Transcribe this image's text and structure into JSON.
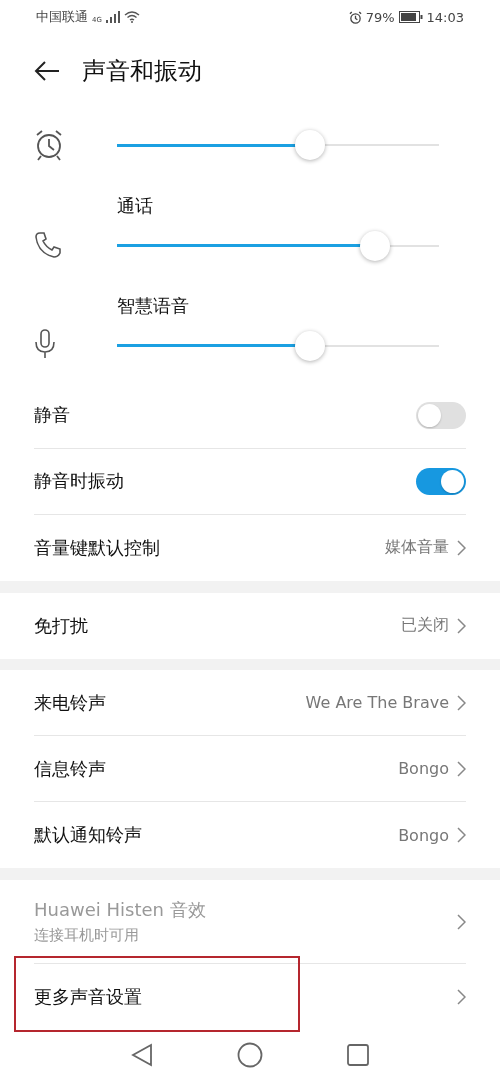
{
  "status_bar": {
    "carrier": "中国联通",
    "network": "4G",
    "battery": "79%",
    "time": "14:03"
  },
  "header": {
    "title": "声音和振动"
  },
  "sections": [
    {
      "items": [
        {
          "kind": "slider",
          "level": 0.6
        },
        {
          "kind": "slider",
          "label": "通话",
          "level": 0.8
        },
        {
          "kind": "slider",
          "label": "智慧语音",
          "level": 0.6
        },
        {
          "kind": "switch",
          "label": "静音",
          "on": false
        },
        {
          "kind": "switch",
          "label": "静音时振动",
          "on": true
        },
        {
          "kind": "value",
          "label": "音量键默认控制",
          "value": "媒体音量"
        }
      ]
    },
    {
      "items": [
        {
          "kind": "value",
          "label": "免打扰",
          "value": "已关闭"
        }
      ]
    },
    {
      "items": [
        {
          "kind": "value",
          "label": "来电铃声",
          "value": "We Are The Brave"
        },
        {
          "kind": "value",
          "label": "信息铃声",
          "value": "Bongo"
        },
        {
          "kind": "value",
          "label": "默认通知铃声",
          "value": "Bongo"
        }
      ]
    },
    {
      "items": [
        {
          "kind": "value",
          "label": "Huawei Histen 音效",
          "subtitle": "连接耳机时可用",
          "disabled": true
        },
        {
          "kind": "value",
          "label": "更多声音设置",
          "highlighted": true
        }
      ]
    }
  ]
}
